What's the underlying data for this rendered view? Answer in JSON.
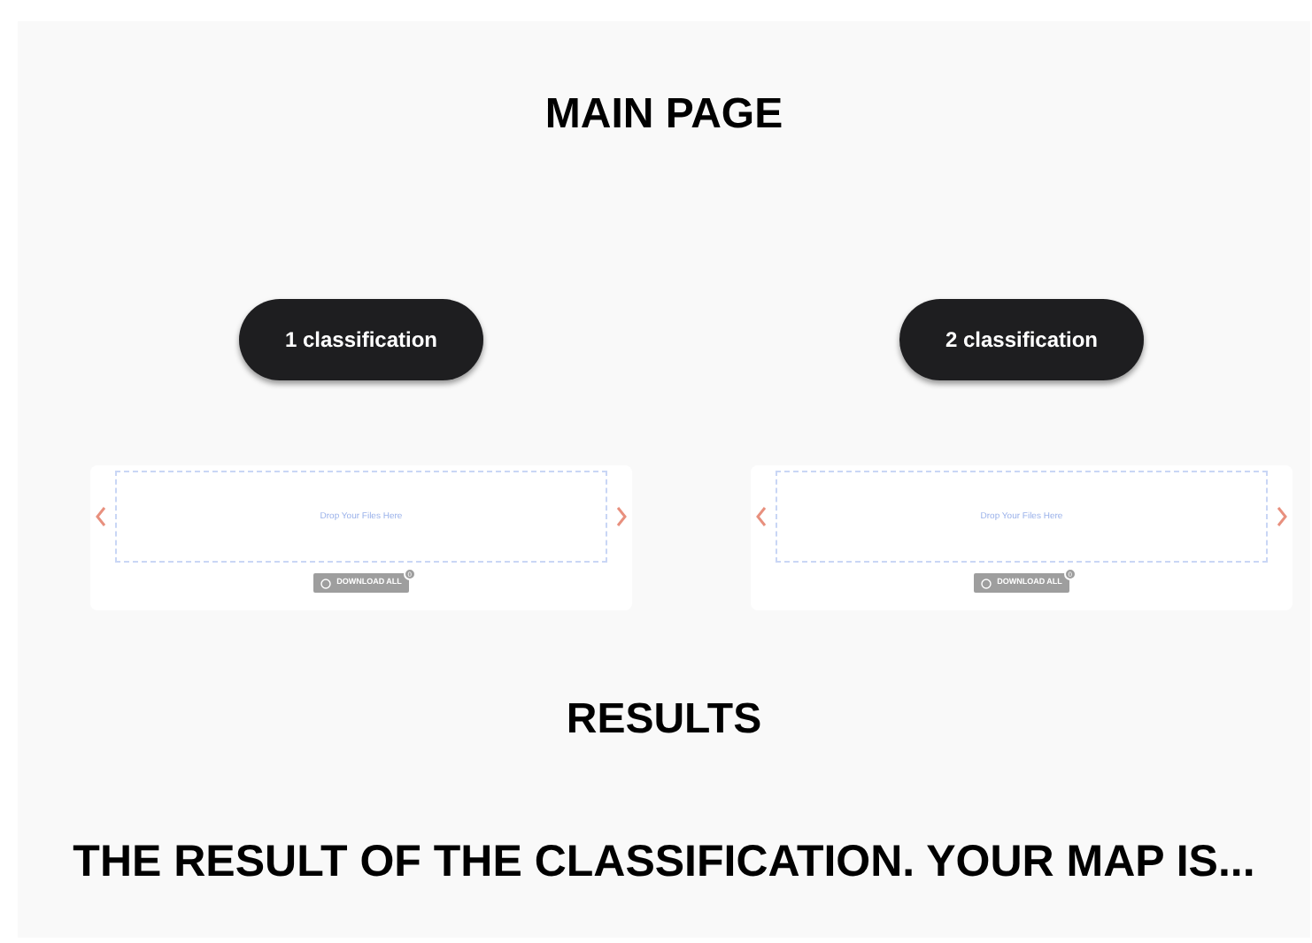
{
  "title": "MAIN PAGE",
  "panels": [
    {
      "button": "1 classification",
      "dropzone": {
        "placeholder": "Drop Your Files Here"
      },
      "download": "DOWNLOAD ALL",
      "count": "0"
    },
    {
      "button": "2 classification",
      "dropzone": {
        "placeholder": "Drop Your Files Here"
      },
      "download": "DOWNLOAD ALL",
      "count": "0"
    }
  ],
  "results_heading": "RESULTS",
  "result_text": "THE RESULT OF THE CLASSIFICATION. YOUR MAP IS..."
}
